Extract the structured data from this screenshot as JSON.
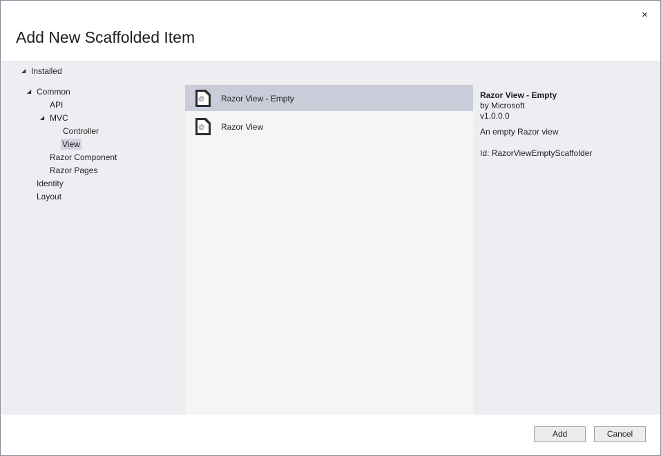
{
  "dialog": {
    "title": "Add New Scaffolded Item",
    "close_icon": "×"
  },
  "tree": {
    "installed": "Installed",
    "common": "Common",
    "api": "API",
    "mvc": "MVC",
    "controller": "Controller",
    "view": "View",
    "razor_component": "Razor Component",
    "razor_pages": "Razor Pages",
    "identity": "Identity",
    "layout": "Layout",
    "expand_glyph": "◢"
  },
  "list": {
    "items": [
      {
        "label": "Razor View - Empty",
        "icon": "@"
      },
      {
        "label": "Razor View",
        "icon": "@"
      }
    ]
  },
  "details": {
    "name": "Razor View - Empty",
    "author": "by Microsoft",
    "version": "v1.0.0.0",
    "description": "An empty Razor view",
    "id": "Id: RazorViewEmptyScaffolder"
  },
  "footer": {
    "add": "Add",
    "cancel": "Cancel"
  }
}
